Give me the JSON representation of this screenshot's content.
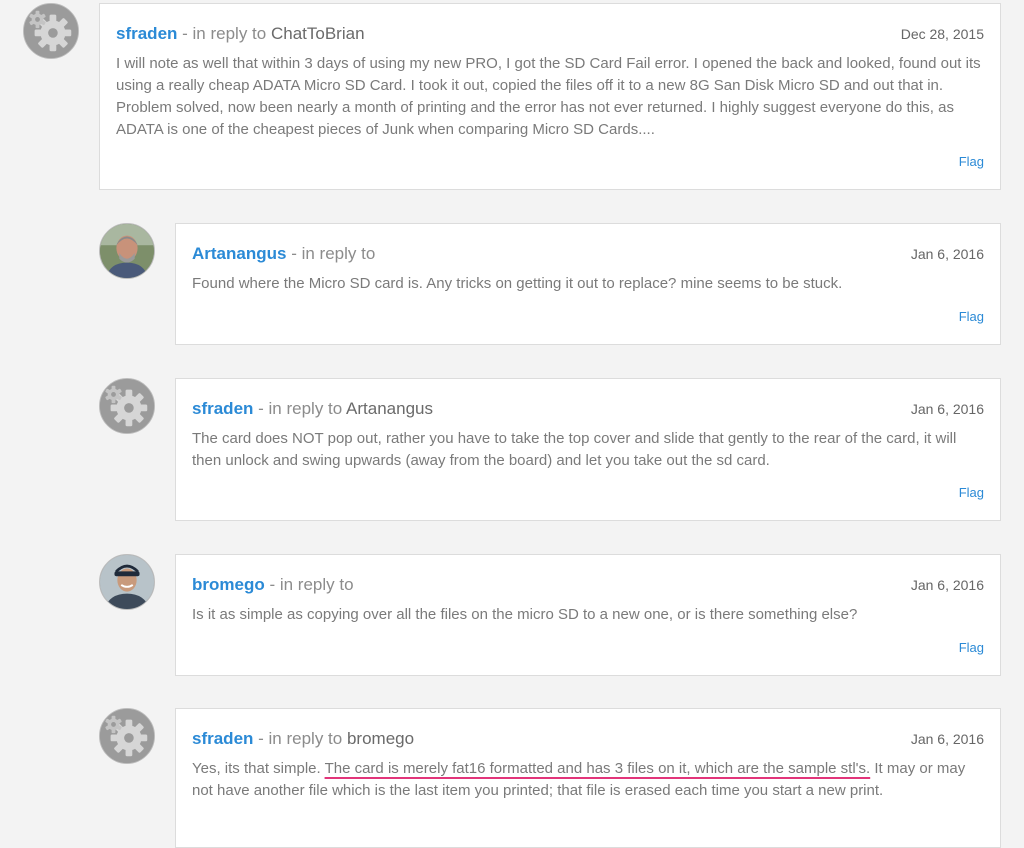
{
  "comments": [
    {
      "author": "sfraden",
      "reply_prefix": " - in reply to ",
      "reply_to": "ChatToBrian",
      "date": "Dec 28, 2015",
      "body": "I will note as well that within 3 days of using my new PRO, I got the SD Card Fail error. I opened the back and looked, found out its using a really cheap ADATA Micro SD Card. I took it out, copied the files off it to a new 8G San Disk Micro SD and out that in. Problem solved, now been nearly a month of printing and the error has not ever returned. I highly suggest everyone do this, as ADATA is one of the cheapest pieces of Junk when comparing Micro SD Cards....",
      "flag": "Flag",
      "avatar_icon": "gear-icon"
    },
    {
      "author": "Artanangus",
      "reply_prefix": " - in reply to",
      "reply_to": "",
      "date": "Jan 6, 2016",
      "body": "Found where the Micro SD card is. Any tricks on getting it out to replace? mine seems to be stuck.",
      "flag": "Flag",
      "avatar_icon": "user-photo-icon"
    },
    {
      "author": "sfraden",
      "reply_prefix": " - in reply to ",
      "reply_to": "Artanangus",
      "date": "Jan 6, 2016",
      "body": "The card does NOT pop out, rather you have to take the top cover and slide that gently to the rear of the card, it will then unlock and swing upwards (away from the board) and let you take out the sd card.",
      "flag": "Flag",
      "avatar_icon": "gear-icon"
    },
    {
      "author": "bromego",
      "reply_prefix": " - in reply to",
      "reply_to": "",
      "date": "Jan 6, 2016",
      "body": "Is it as simple as copying over all the files on the micro SD to a new one, or is there something else?",
      "flag": "Flag",
      "avatar_icon": "user-photo-icon"
    },
    {
      "author": "sfraden",
      "reply_prefix": " - in reply to ",
      "reply_to": "bromego",
      "date": "Jan 6, 2016",
      "body_before": "Yes, its that simple. ",
      "body_highlight": "The card is merely fat16 formatted and has 3 files on it, which are the sample stl's.",
      "body_after": " It may or may not have another file which is the last item you printed; that file is erased each time you start a new print.",
      "avatar_icon": "gear-icon"
    }
  ],
  "colors": {
    "link": "#2b8ad6",
    "highlight_underline": "#e2357a",
    "page_background": "#f3f3f3"
  }
}
